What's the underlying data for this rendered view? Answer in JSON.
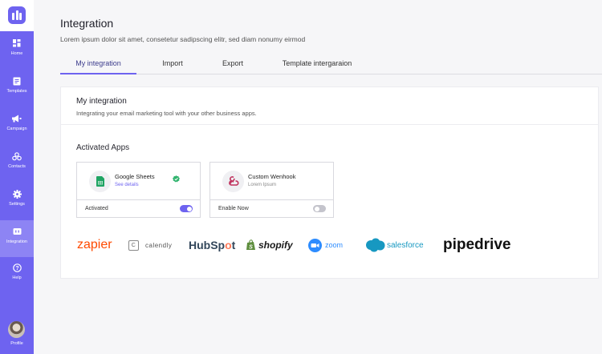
{
  "sidebar": {
    "items": [
      {
        "label": "Home",
        "icon": "grid-icon"
      },
      {
        "label": "Templates",
        "icon": "document-icon"
      },
      {
        "label": "Campaign",
        "icon": "megaphone-icon"
      },
      {
        "label": "Contacts",
        "icon": "contacts-icon"
      },
      {
        "label": "Settings",
        "icon": "gear-icon"
      },
      {
        "label": "Integration",
        "icon": "integration-icon"
      },
      {
        "label": "Help",
        "icon": "help-icon"
      }
    ],
    "profile_label": "Profile",
    "active": "Integration"
  },
  "header": {
    "title": "Integration",
    "subtitle": "Lorem ipsum dolor sit amet, consetetur sadipscing elitr, sed diam nonumy eirmod"
  },
  "tabs": [
    {
      "label": "My integration",
      "active": true
    },
    {
      "label": "Import",
      "active": false
    },
    {
      "label": "Export",
      "active": false
    },
    {
      "label": "Template intergaraion",
      "active": false
    }
  ],
  "card": {
    "title": "My integration",
    "description": "Integrating your email marketing tool with your other business apps.",
    "section_title": "Activated Apps",
    "apps": [
      {
        "name": "Google Sheets",
        "sub": "See details",
        "status": "Activated",
        "enabled": true,
        "verified": true
      },
      {
        "name": "Custom Wenhook",
        "sub": "Lorem Ipsum",
        "status": "Enable Now",
        "enabled": false,
        "verified": false
      }
    ],
    "brands": {
      "zapier": "zapier",
      "calendly": "calendly",
      "calendly_mark": "C",
      "hubspot_a": "HubSp",
      "hubspot_b": "o",
      "hubspot_c": "t",
      "shopify": "shopify",
      "zoom": "zoom",
      "salesforce": "salesforce",
      "pipedrive": "pipedrive"
    }
  },
  "colors": {
    "accent": "#6e63f0",
    "sidebar_active": "#8d84f4",
    "verified": "#2fb36d"
  }
}
